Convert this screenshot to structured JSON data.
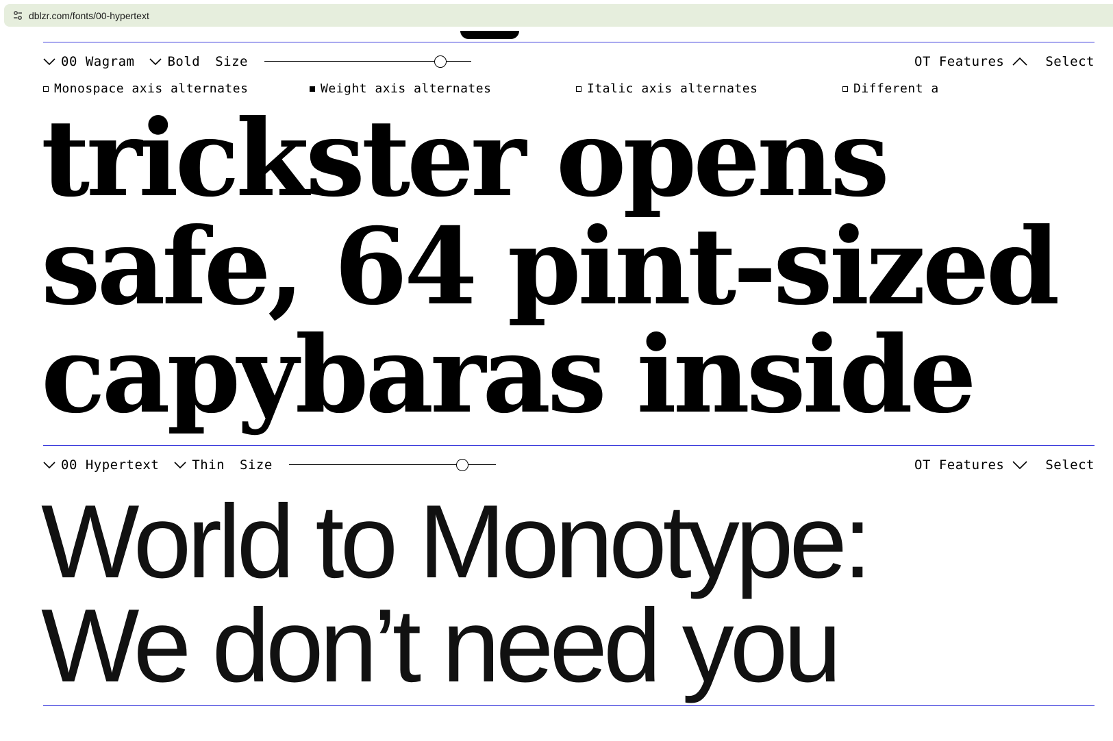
{
  "browser": {
    "url": "dblzr.com/fonts/00-hypertext"
  },
  "tester_1": {
    "family": "00 Wagram",
    "weight": "Bold",
    "size_label": "Size",
    "size_value": 0.85,
    "ot_label": "OT Features",
    "ot_expanded": true,
    "select_label": "Select",
    "features": [
      {
        "label": "Monospace axis alternates",
        "checked": false
      },
      {
        "label": "Weight axis alternates",
        "checked": true
      },
      {
        "label": "Italic axis alternates",
        "checked": false
      },
      {
        "label": "Different a",
        "checked": false
      }
    ],
    "sample_lines": [
      "trickster opens",
      "safe, 64 pint-sized",
      "capybaras inside"
    ]
  },
  "tester_2": {
    "family": "00 Hypertext",
    "weight": "Thin",
    "size_label": "Size",
    "size_value": 0.84,
    "ot_label": "OT Features",
    "ot_expanded": false,
    "select_label": "Select",
    "sample_lines": [
      "World to Monotype:",
      "We don’t need you"
    ]
  }
}
